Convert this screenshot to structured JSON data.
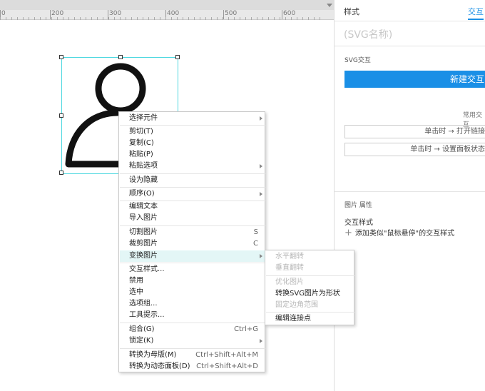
{
  "ruler": {
    "labels": [
      "0",
      "200",
      "300",
      "400",
      "500",
      "600"
    ]
  },
  "panel": {
    "tabs": {
      "style": "样式",
      "interaction": "交互"
    },
    "svg_name_placeholder": "(SVG名称)",
    "svg_interaction_label": "SVG交互",
    "new_interaction_button": "新建交互",
    "common_interactions_label": "常用交互",
    "events": [
      "单击时 → 打开链接",
      "单击时 → 设置面板状态"
    ],
    "image_props_label": "图片 属性",
    "interaction_style_label": "交互样式",
    "add_style_text": "添加类似\"鼠标悬停\"的交互样式"
  },
  "context_menu": {
    "items": [
      {
        "label": "选择元件",
        "submenu": true
      },
      {
        "label": "剪切(T)"
      },
      {
        "label": "复制(C)"
      },
      {
        "label": "粘贴(P)"
      },
      {
        "label": "粘贴选项",
        "submenu": true
      },
      {
        "label": "设为隐藏"
      },
      {
        "label": "顺序(O)",
        "submenu": true
      },
      {
        "label": "编辑文本"
      },
      {
        "label": "导入图片"
      },
      {
        "label": "切割图片",
        "shortcut": "S"
      },
      {
        "label": "裁剪图片",
        "shortcut": "C"
      },
      {
        "label": "变换图片",
        "submenu": true
      },
      {
        "label": "交互样式..."
      },
      {
        "label": "禁用"
      },
      {
        "label": "选中"
      },
      {
        "label": "选项组..."
      },
      {
        "label": "工具提示..."
      },
      {
        "label": "组合(G)",
        "shortcut": "Ctrl+G"
      },
      {
        "label": "锁定(K)",
        "submenu": true
      },
      {
        "label": "转换为母版(M)",
        "shortcut": "Ctrl+Shift+Alt+M"
      },
      {
        "label": "转换为动态面板(D)",
        "shortcut": "Ctrl+Shift+Alt+D"
      }
    ]
  },
  "transform_submenu": {
    "items": [
      {
        "label": "水平翻转",
        "disabled": true
      },
      {
        "label": "垂直翻转",
        "disabled": true
      },
      {
        "label": "优化图片",
        "disabled": true
      },
      {
        "label": "转换SVG图片为形状",
        "disabled": false
      },
      {
        "label": "固定边角范围",
        "disabled": true
      },
      {
        "label": "编辑连接点",
        "disabled": false
      }
    ]
  },
  "colors": {
    "accent": "#1a8fe6",
    "selection": "#4fd8e0",
    "highlight": "#e3f6f6"
  }
}
